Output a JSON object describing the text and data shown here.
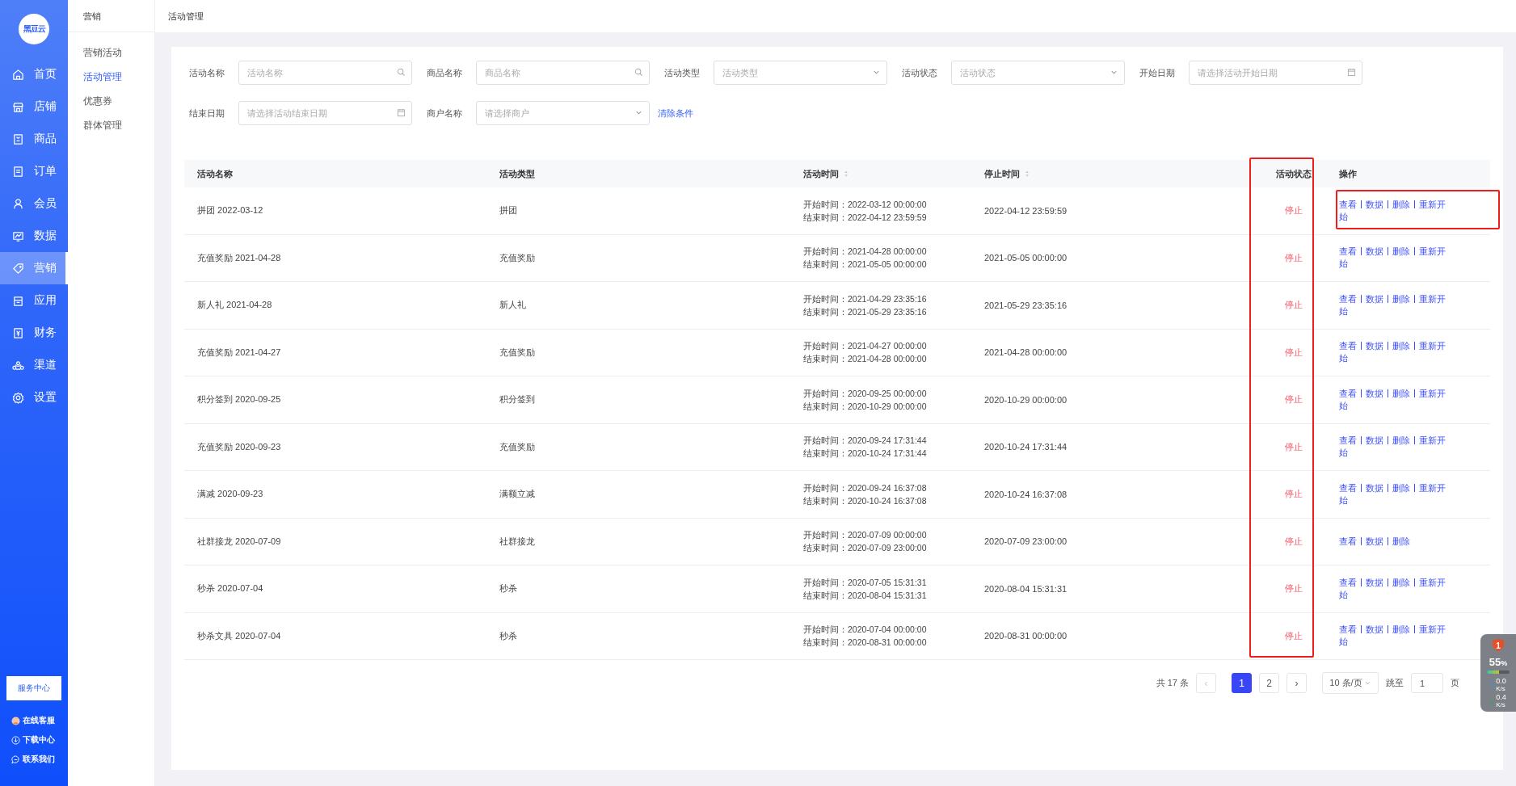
{
  "sidebar": {
    "items": [
      {
        "label": "首页",
        "selected": false
      },
      {
        "label": "店铺",
        "selected": false
      },
      {
        "label": "商品",
        "selected": false
      },
      {
        "label": "订单",
        "selected": false
      },
      {
        "label": "会员",
        "selected": false
      },
      {
        "label": "数据",
        "selected": false
      },
      {
        "label": "营销",
        "selected": true
      },
      {
        "label": "应用",
        "selected": false
      },
      {
        "label": "财务",
        "selected": false
      },
      {
        "label": "渠道",
        "selected": false
      },
      {
        "label": "设置",
        "selected": false
      }
    ],
    "logo": "黑豆云",
    "service_button": "服务中心",
    "links": [
      {
        "kind": "avatar",
        "label": "在线客服"
      },
      {
        "kind": "download",
        "label": "下载中心"
      },
      {
        "kind": "chat",
        "label": "联系我们"
      }
    ]
  },
  "submenu": {
    "title": "营销",
    "items": [
      {
        "label": "营销活动",
        "selected": false
      },
      {
        "label": "活动管理",
        "selected": true
      },
      {
        "label": "优惠券",
        "selected": false
      },
      {
        "label": "群体管理",
        "selected": false
      }
    ]
  },
  "page_title": "活动管理",
  "filters": [
    {
      "label": "活动名称",
      "kind": "search",
      "placeholder": "活动名称"
    },
    {
      "label": "商品名称",
      "kind": "search",
      "placeholder": "商品名称"
    },
    {
      "label": "活动类型",
      "kind": "select",
      "placeholder": "活动类型"
    },
    {
      "label": "活动状态",
      "kind": "select",
      "placeholder": "活动状态"
    },
    {
      "label": "开始日期",
      "kind": "date",
      "placeholder": "请选择活动开始日期"
    },
    {
      "label": "结束日期",
      "kind": "date",
      "placeholder": "请选择活动结束日期"
    },
    {
      "label": "商户名称",
      "kind": "select",
      "placeholder": "请选择商户"
    }
  ],
  "clear_link": "清除条件",
  "table": {
    "highlight_status_column": true,
    "highlight_first_row_actions": true,
    "columns": [
      {
        "label": "活动名称",
        "sortable": false
      },
      {
        "label": "活动类型",
        "sortable": false
      },
      {
        "label": "活动时间",
        "sortable": true
      },
      {
        "label": "停止时间",
        "sortable": true
      },
      {
        "label": "活动状态",
        "sortable": false
      },
      {
        "label": "操作",
        "sortable": false
      }
    ],
    "rows": [
      {
        "name": "拼团 2022-03-12",
        "type": "拼团",
        "start": "开始时间：2022-03-12 00:00:00",
        "end": "结束时间：2022-04-12 23:59:59",
        "stop": "2022-04-12 23:59:59",
        "status": "停止",
        "actions": [
          "查看",
          "数据",
          "删除",
          "重新开始"
        ]
      },
      {
        "name": "充值奖励 2021-04-28",
        "type": "充值奖励",
        "start": "开始时间：2021-04-28 00:00:00",
        "end": "结束时间：2021-05-05 00:00:00",
        "stop": "2021-05-05 00:00:00",
        "status": "停止",
        "actions": [
          "查看",
          "数据",
          "删除",
          "重新开始"
        ]
      },
      {
        "name": "新人礼 2021-04-28",
        "type": "新人礼",
        "start": "开始时间：2021-04-29 23:35:16",
        "end": "结束时间：2021-05-29 23:35:16",
        "stop": "2021-05-29 23:35:16",
        "status": "停止",
        "actions": [
          "查看",
          "数据",
          "删除",
          "重新开始"
        ]
      },
      {
        "name": "充值奖励 2021-04-27",
        "type": "充值奖励",
        "start": "开始时间：2021-04-27 00:00:00",
        "end": "结束时间：2021-04-28 00:00:00",
        "stop": "2021-04-28 00:00:00",
        "status": "停止",
        "actions": [
          "查看",
          "数据",
          "删除",
          "重新开始"
        ]
      },
      {
        "name": "积分签到 2020-09-25",
        "type": "积分签到",
        "start": "开始时间：2020-09-25 00:00:00",
        "end": "结束时间：2020-10-29 00:00:00",
        "stop": "2020-10-29 00:00:00",
        "status": "停止",
        "actions": [
          "查看",
          "数据",
          "删除",
          "重新开始"
        ]
      },
      {
        "name": "充值奖励 2020-09-23",
        "type": "充值奖励",
        "start": "开始时间：2020-09-24 17:31:44",
        "end": "结束时间：2020-10-24 17:31:44",
        "stop": "2020-10-24 17:31:44",
        "status": "停止",
        "actions": [
          "查看",
          "数据",
          "删除",
          "重新开始"
        ]
      },
      {
        "name": "满减 2020-09-23",
        "type": "满额立减",
        "start": "开始时间：2020-09-24 16:37:08",
        "end": "结束时间：2020-10-24 16:37:08",
        "stop": "2020-10-24 16:37:08",
        "status": "停止",
        "actions": [
          "查看",
          "数据",
          "删除",
          "重新开始"
        ]
      },
      {
        "name": "社群接龙 2020-07-09",
        "type": "社群接龙",
        "start": "开始时间：2020-07-09 00:00:00",
        "end": "结束时间：2020-07-09 23:00:00",
        "stop": "2020-07-09 23:00:00",
        "status": "停止",
        "actions": [
          "查看",
          "数据",
          "删除"
        ]
      },
      {
        "name": "秒杀 2020-07-04",
        "type": "秒杀",
        "start": "开始时间：2020-07-05 15:31:31",
        "end": "结束时间：2020-08-04 15:31:31",
        "stop": "2020-08-04 15:31:31",
        "status": "停止",
        "actions": [
          "查看",
          "数据",
          "删除",
          "重新开始"
        ]
      },
      {
        "name": "秒杀文具 2020-07-04",
        "type": "秒杀",
        "start": "开始时间：2020-07-04 00:00:00",
        "end": "结束时间：2020-08-31 00:00:00",
        "stop": "2020-08-31 00:00:00",
        "status": "停止",
        "actions": [
          "查看",
          "数据",
          "删除",
          "重新开始"
        ]
      }
    ]
  },
  "pagination": {
    "total": "共 17 条",
    "prev": "‹",
    "next": "›",
    "pages": [
      {
        "label": "1",
        "selected": true
      },
      {
        "label": "2",
        "selected": false
      }
    ],
    "page_size": "10 条/页",
    "jump_label": "跳至",
    "jump_value": "1",
    "jump_suffix": "页"
  },
  "net_monitor": {
    "badge": "1",
    "percent": "55",
    "percent_unit": "%",
    "level": 0.55,
    "up": "0.0",
    "up_unit": "K/s",
    "down": "0.4",
    "down_unit": "K/s"
  }
}
